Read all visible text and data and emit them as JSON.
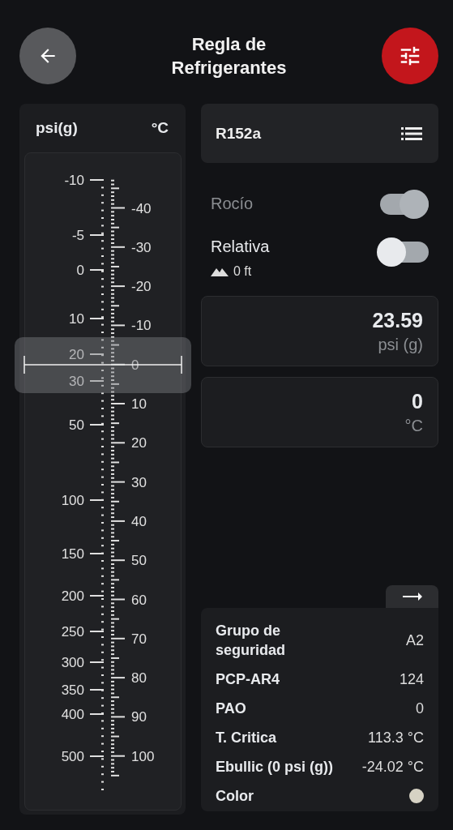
{
  "header": {
    "title": "Regla de Refrigerantes"
  },
  "ruler": {
    "left_unit": "psi(g)",
    "right_unit": "°C",
    "left_labels": [
      "-10",
      "-5",
      "0",
      "10",
      "20",
      "30",
      "50",
      "100",
      "150",
      "200",
      "250",
      "300",
      "350",
      "400",
      "500"
    ],
    "right_labels": [
      "-40",
      "-30",
      "-20",
      "-10",
      "0",
      "10",
      "20",
      "30",
      "40",
      "50",
      "60",
      "70",
      "80",
      "90",
      "100"
    ]
  },
  "refrigerant": {
    "name": "R152a"
  },
  "toggles": [
    {
      "label": "Rocío",
      "on": true,
      "disabled": true
    },
    {
      "label": "Relativa",
      "on": false,
      "disabled": false,
      "altitude": "0 ft"
    }
  ],
  "fields": [
    {
      "value": "23.59",
      "unit": "psi (g)"
    },
    {
      "value": "0",
      "unit": "°C"
    }
  ],
  "info": [
    {
      "kind": "text",
      "label": "Grupo de seguridad",
      "value": "A2"
    },
    {
      "kind": "text",
      "label": "PCP-AR4",
      "value": "124"
    },
    {
      "kind": "text",
      "label": "PAO",
      "value": "0"
    },
    {
      "kind": "text",
      "label": "T. Critica",
      "value": "113.3 °C"
    },
    {
      "kind": "text",
      "label": "Ebullic (0 psi (g))",
      "value": "-24.02 °C"
    },
    {
      "kind": "swatch",
      "label": "Color",
      "color": "#d6d2c4"
    }
  ]
}
